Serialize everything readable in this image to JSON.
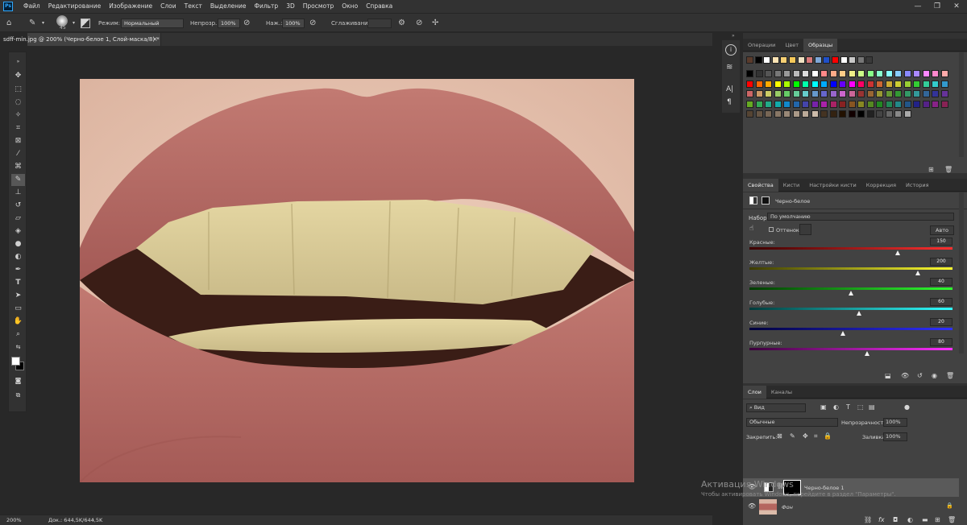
{
  "menu": [
    "Файл",
    "Редактирование",
    "Изображение",
    "Слои",
    "Текст",
    "Выделение",
    "Фильтр",
    "3D",
    "Просмотр",
    "Окно",
    "Справка"
  ],
  "app_logo": "Ps",
  "options": {
    "brush_size": "45",
    "mode_label": "Режим:",
    "mode_value": "Нормальный",
    "opacity_label": "Непрозр.:",
    "opacity_value": "100%",
    "flow_label": "Наж.:",
    "flow_value": "100%",
    "smoothing_label": "Сглаживание:"
  },
  "document": {
    "tab_title": "sdff-min.jpg @ 200% (Черно-белое 1, Слой-маска/8) *",
    "close": "×"
  },
  "status": {
    "zoom": "200%",
    "doc": "Док.: 644,5K/644,5K"
  },
  "swatches_panel": {
    "tabs": [
      "Операции",
      "Цвет",
      "Образцы"
    ],
    "active": 2
  },
  "properties_panel": {
    "tabs": [
      "Свойства",
      "Кисти",
      "Настройки кисти",
      "Коррекция",
      "История"
    ],
    "title": "Черно-белое",
    "preset_label": "Набор:",
    "preset_value": "По умолчанию",
    "tint_label": "Оттенок",
    "auto_label": "Авто",
    "sliders": [
      {
        "label": "Красные:",
        "value": "150",
        "pos": 0.73,
        "colors": [
          "#3b0000",
          "#ff3030"
        ]
      },
      {
        "label": "Желтые:",
        "value": "200",
        "pos": 0.83,
        "colors": [
          "#3b3b00",
          "#ffff30"
        ]
      },
      {
        "label": "Зеленые:",
        "value": "40",
        "pos": 0.5,
        "colors": [
          "#003b00",
          "#30ff30"
        ]
      },
      {
        "label": "Голубые:",
        "value": "60",
        "pos": 0.54,
        "colors": [
          "#003b3b",
          "#30ffff"
        ]
      },
      {
        "label": "Синие:",
        "value": "20",
        "pos": 0.46,
        "colors": [
          "#00003b",
          "#3030ff"
        ]
      },
      {
        "label": "Пурпурные:",
        "value": "80",
        "pos": 0.58,
        "colors": [
          "#3b003b",
          "#ff30ff"
        ]
      }
    ]
  },
  "layers_panel": {
    "tabs": [
      "Слои",
      "Каналы"
    ],
    "filter_label": "Вид",
    "blend_mode": "Обычные",
    "opacity_label": "Непрозрачность:",
    "opacity_value": "100%",
    "lock_label": "Закрепить:",
    "fill_label": "Заливка:",
    "fill_value": "100%",
    "layers": [
      {
        "name": "Черно-белое 1"
      },
      {
        "name": "Фон"
      }
    ]
  },
  "watermark": {
    "title": "Активация Windows",
    "subtitle": "Чтобы активировать Windows, перейдите в раздел \"Параметры\"."
  },
  "colors": {
    "accent": "#31a8ff",
    "panel": "#323232",
    "canvas": "#282828"
  }
}
